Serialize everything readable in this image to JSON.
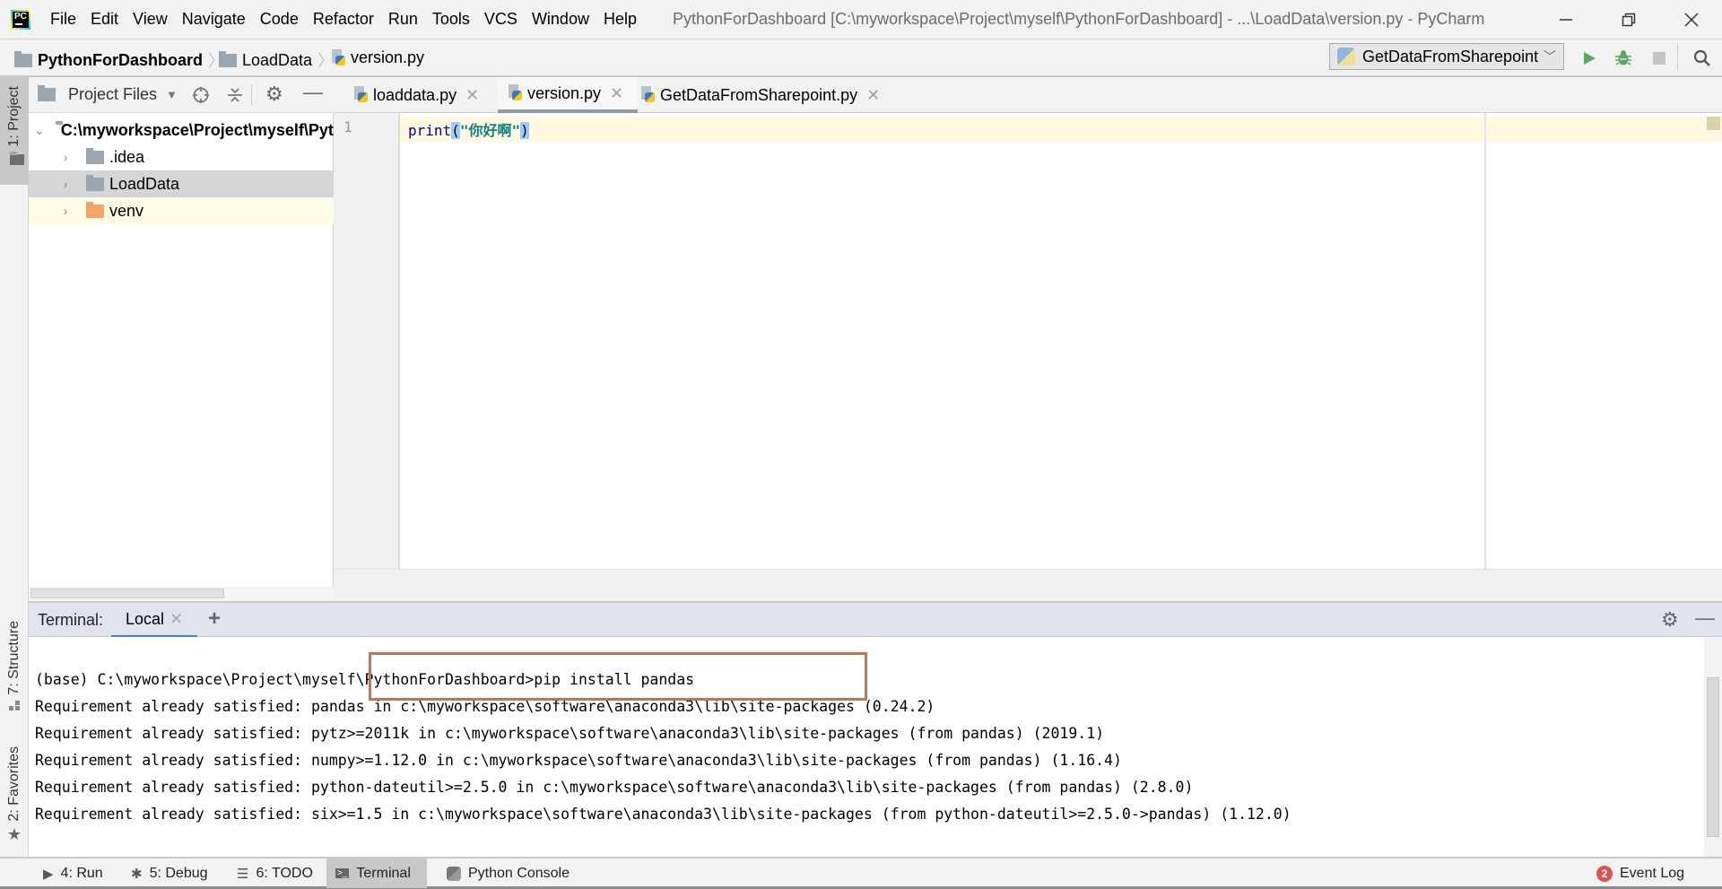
{
  "window": {
    "app_icon": "pycharm-logo",
    "title": "PythonForDashboard [C:\\myworkspace\\Project\\myself\\PythonForDashboard] - ...\\LoadData\\version.py - PyCharm",
    "controls": [
      "minimize",
      "restore",
      "close"
    ]
  },
  "menu": [
    {
      "label": "File"
    },
    {
      "label": "Edit"
    },
    {
      "label": "View"
    },
    {
      "label": "Navigate"
    },
    {
      "label": "Code"
    },
    {
      "label": "Refactor"
    },
    {
      "label": "Run"
    },
    {
      "label": "Tools"
    },
    {
      "label": "VCS"
    },
    {
      "label": "Window"
    },
    {
      "label": "Help"
    }
  ],
  "breadcrumb": [
    {
      "label": "PythonForDashboard",
      "icon": "folder-icon"
    },
    {
      "label": "LoadData",
      "icon": "folder-icon"
    },
    {
      "label": "version.py",
      "icon": "python-file-icon"
    }
  ],
  "toolbar": {
    "run_config": "GetDataFromSharepoint",
    "run_icon_color": "#59a869",
    "debug_icon_color": "#59a869"
  },
  "left_strip": {
    "project_tab": "1: Project",
    "structure_tab": "7: Structure",
    "favorites_tab": "2: Favorites"
  },
  "project_panel": {
    "view_label": "Project Files",
    "tree": [
      {
        "label": "C:\\myworkspace\\Project\\myself\\PythonForDashboard",
        "expanded": true,
        "bold": true,
        "level": 0
      },
      {
        "label": ".idea",
        "expanded": false,
        "level": 1,
        "color": "#9aa7b0"
      },
      {
        "label": "LoadData",
        "expanded": false,
        "level": 1,
        "selected": true,
        "color": "#9aa7b0"
      },
      {
        "label": "venv",
        "expanded": false,
        "level": 1,
        "color": "#f4a46b",
        "highlighted": true
      }
    ]
  },
  "editor": {
    "tabs": [
      {
        "label": "loaddata.py",
        "active": false
      },
      {
        "label": "version.py",
        "active": true
      },
      {
        "label": "GetDataFromSharepoint.py",
        "active": false
      }
    ],
    "lines": [
      {
        "number": "1",
        "code_fn": "print",
        "code_open": "(",
        "code_str": "\"你好啊\"",
        "code_close": ")"
      }
    ]
  },
  "terminal": {
    "label": "Terminal:",
    "tab": "Local",
    "lines": [
      "(base) C:\\myworkspace\\Project\\myself\\PythonForDashboard>pip install pandas",
      "Requirement already satisfied: pandas in c:\\myworkspace\\software\\anaconda3\\lib\\site-packages (0.24.2)",
      "Requirement already satisfied: pytz>=2011k in c:\\myworkspace\\software\\anaconda3\\lib\\site-packages (from pandas) (2019.1)",
      "Requirement already satisfied: numpy>=1.12.0 in c:\\myworkspace\\software\\anaconda3\\lib\\site-packages (from pandas) (1.16.4)",
      "Requirement already satisfied: python-dateutil>=2.5.0 in c:\\myworkspace\\software\\anaconda3\\lib\\site-packages (from pandas) (2.8.0)",
      "Requirement already satisfied: six>=1.5 in c:\\myworkspace\\software\\anaconda3\\lib\\site-packages (from python-dateutil>=2.5.0->pandas) (1.12.0)"
    ],
    "highlight_color": "#b87756"
  },
  "bottom_bar": {
    "tabs": [
      {
        "label": "4: Run"
      },
      {
        "label": "5: Debug"
      },
      {
        "label": "6: TODO"
      },
      {
        "label": "Terminal",
        "active": true
      },
      {
        "label": "Python Console"
      }
    ],
    "event_log": {
      "label": "Event Log",
      "count": "2"
    }
  }
}
